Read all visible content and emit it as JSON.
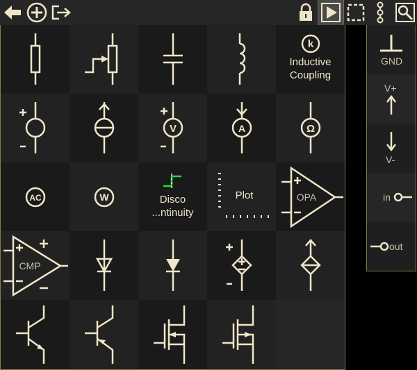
{
  "toolbar": {
    "buttons": [
      "back-arrow",
      "add-circle",
      "exit",
      "lock",
      "play",
      "select-rect",
      "nodes",
      "zoom"
    ]
  },
  "palette": {
    "inductive_coupling_symbol": "k",
    "inductive_coupling_label": "Inductive Coupling",
    "voltmeter_symbol": "V",
    "ammeter_symbol": "A",
    "ohmmeter_symbol": "Ω",
    "ac_symbol": "AC",
    "wattmeter_symbol": "W",
    "discontinuity_label_1": "Disco",
    "discontinuity_label_2": "...ntinuity",
    "plot_label": "Plot",
    "opamp_label": "OPA",
    "comparator_label": "CMP"
  },
  "side": {
    "gnd_label": "GND",
    "vplus_label": "V+",
    "vminus_label": "V-",
    "in_label": "in",
    "out_label": "out"
  },
  "colors": {
    "symbol": "#efe6c8",
    "accent_green": "#22d84a",
    "border": "#8a7a45"
  }
}
